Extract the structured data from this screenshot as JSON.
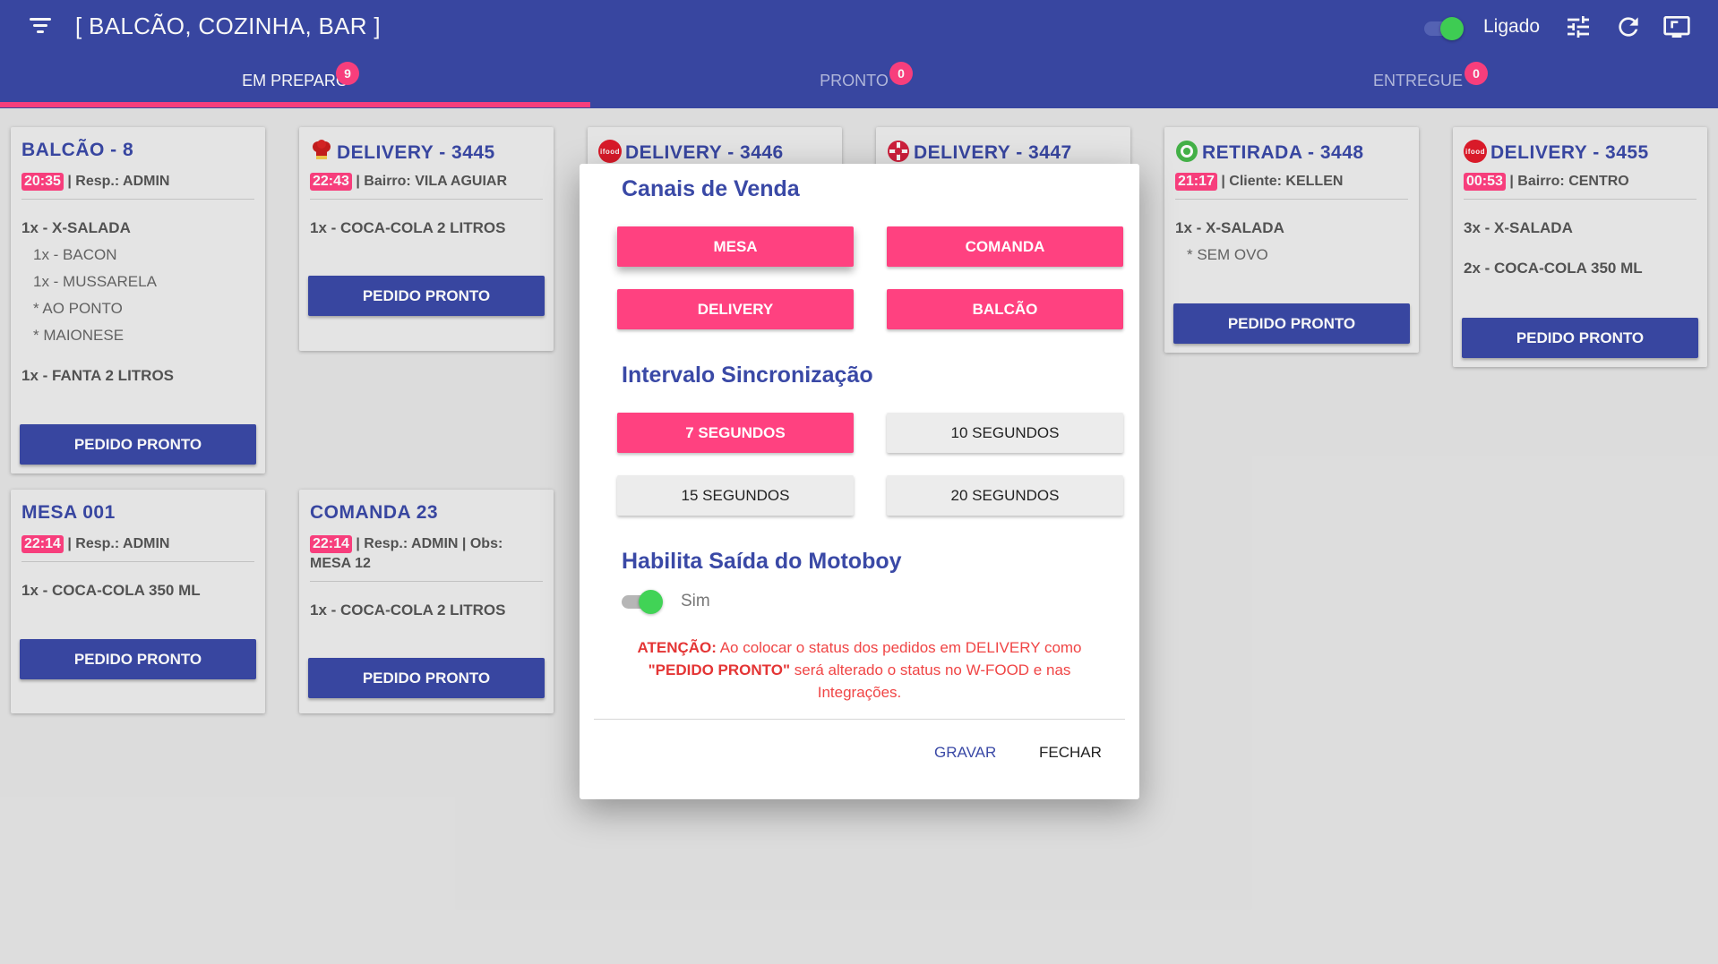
{
  "header": {
    "title": "[ BALCÃO, COZINHA, BAR ]",
    "toggle_label": "Ligado",
    "toggle_on": true,
    "icons": [
      "menu-icon",
      "sliders-icon",
      "refresh-icon",
      "screen-icon"
    ]
  },
  "tabs": [
    {
      "label": "EM PREPARO",
      "count": "9",
      "active": true
    },
    {
      "label": "PRONTO",
      "count": "0",
      "active": false
    },
    {
      "label": "ENTREGUE",
      "count": "0",
      "active": false
    }
  ],
  "colors": {
    "primary": "#3a49a6",
    "accent": "#ff4180",
    "toggle_on": "#41d356",
    "warning": "#f04545"
  },
  "orders": [
    {
      "title": "BALCÃO - 8",
      "time": "20:35",
      "meta": "| Resp.: ADMIN",
      "items": [
        {
          "text": "1x - X-SALADA",
          "subs": [
            "1x - BACON",
            "1x - MUSSARELA",
            "* AO PONTO",
            "* MAIONESE"
          ]
        },
        {
          "text": "1x - FANTA 2 LITROS",
          "subs": []
        }
      ],
      "button": "PEDIDO PRONTO"
    },
    {
      "title": "DELIVERY - 3445",
      "icon": "chef-hat-icon",
      "time": "22:43",
      "meta": "| Bairro: VILA AGUIAR",
      "items": [
        {
          "text": "1x - COCA-COLA 2 LITROS",
          "subs": []
        }
      ],
      "button": "PEDIDO PRONTO"
    },
    {
      "title": "DELIVERY - 3446",
      "icon": "ifood-logo-icon",
      "icon_text": "ifood"
    },
    {
      "title": "DELIVERY - 3447",
      "icon": "aiqfome-logo-icon"
    },
    {
      "title": "RETIRADA - 3448",
      "icon": "pickup-icon",
      "time": "21:17",
      "meta": "| Cliente: KELLEN",
      "items": [
        {
          "text": "1x - X-SALADA",
          "subs": [
            "* SEM OVO"
          ]
        }
      ],
      "button": "PEDIDO PRONTO"
    },
    {
      "title": "DELIVERY - 3455",
      "icon": "ifood-logo-icon",
      "icon_text": "ifood",
      "time": "00:53",
      "meta": "| Bairro: CENTRO",
      "items": [
        {
          "text": "3x - X-SALADA",
          "subs": []
        },
        {
          "text": "2x - COCA-COLA 350 ML",
          "subs": []
        }
      ],
      "button": "PEDIDO PRONTO"
    },
    {
      "title": "MESA 001",
      "time": "22:14",
      "meta": "| Resp.: ADMIN",
      "items": [
        {
          "text": "1x - COCA-COLA 350 ML",
          "subs": []
        }
      ],
      "button": "PEDIDO PRONTO"
    },
    {
      "title": "COMANDA 23",
      "time": "22:14",
      "meta": "| Resp.: ADMIN | Obs: MESA 12",
      "items": [
        {
          "text": "1x - COCA-COLA 2 LITROS",
          "subs": []
        }
      ],
      "button": "PEDIDO PRONTO"
    }
  ],
  "dialog": {
    "channels_heading": "Canais de Venda",
    "channels": [
      {
        "label": "MESA",
        "selected": true
      },
      {
        "label": "COMANDA",
        "selected": true
      },
      {
        "label": "DELIVERY",
        "selected": true
      },
      {
        "label": "BALCÃO",
        "selected": true
      }
    ],
    "interval_heading": "Intervalo Sincronização",
    "intervals": [
      {
        "label": "7 SEGUNDOS",
        "selected": true
      },
      {
        "label": "10 SEGUNDOS",
        "selected": false
      },
      {
        "label": "15 SEGUNDOS",
        "selected": false
      },
      {
        "label": "20 SEGUNDOS",
        "selected": false
      }
    ],
    "motoboy_heading": "Habilita Saída do Motoboy",
    "motoboy_toggle_on": true,
    "motoboy_label": "Sim",
    "warning": {
      "strong1": "ATENÇÃO:",
      "text1": " Ao colocar o status dos pedidos em DELIVERY como ",
      "strong2": "\"PEDIDO PRONTO\"",
      "text2": " será alterado o status no W-FOOD e nas Integrações."
    },
    "save_label": "GRAVAR",
    "close_label": "FECHAR"
  }
}
